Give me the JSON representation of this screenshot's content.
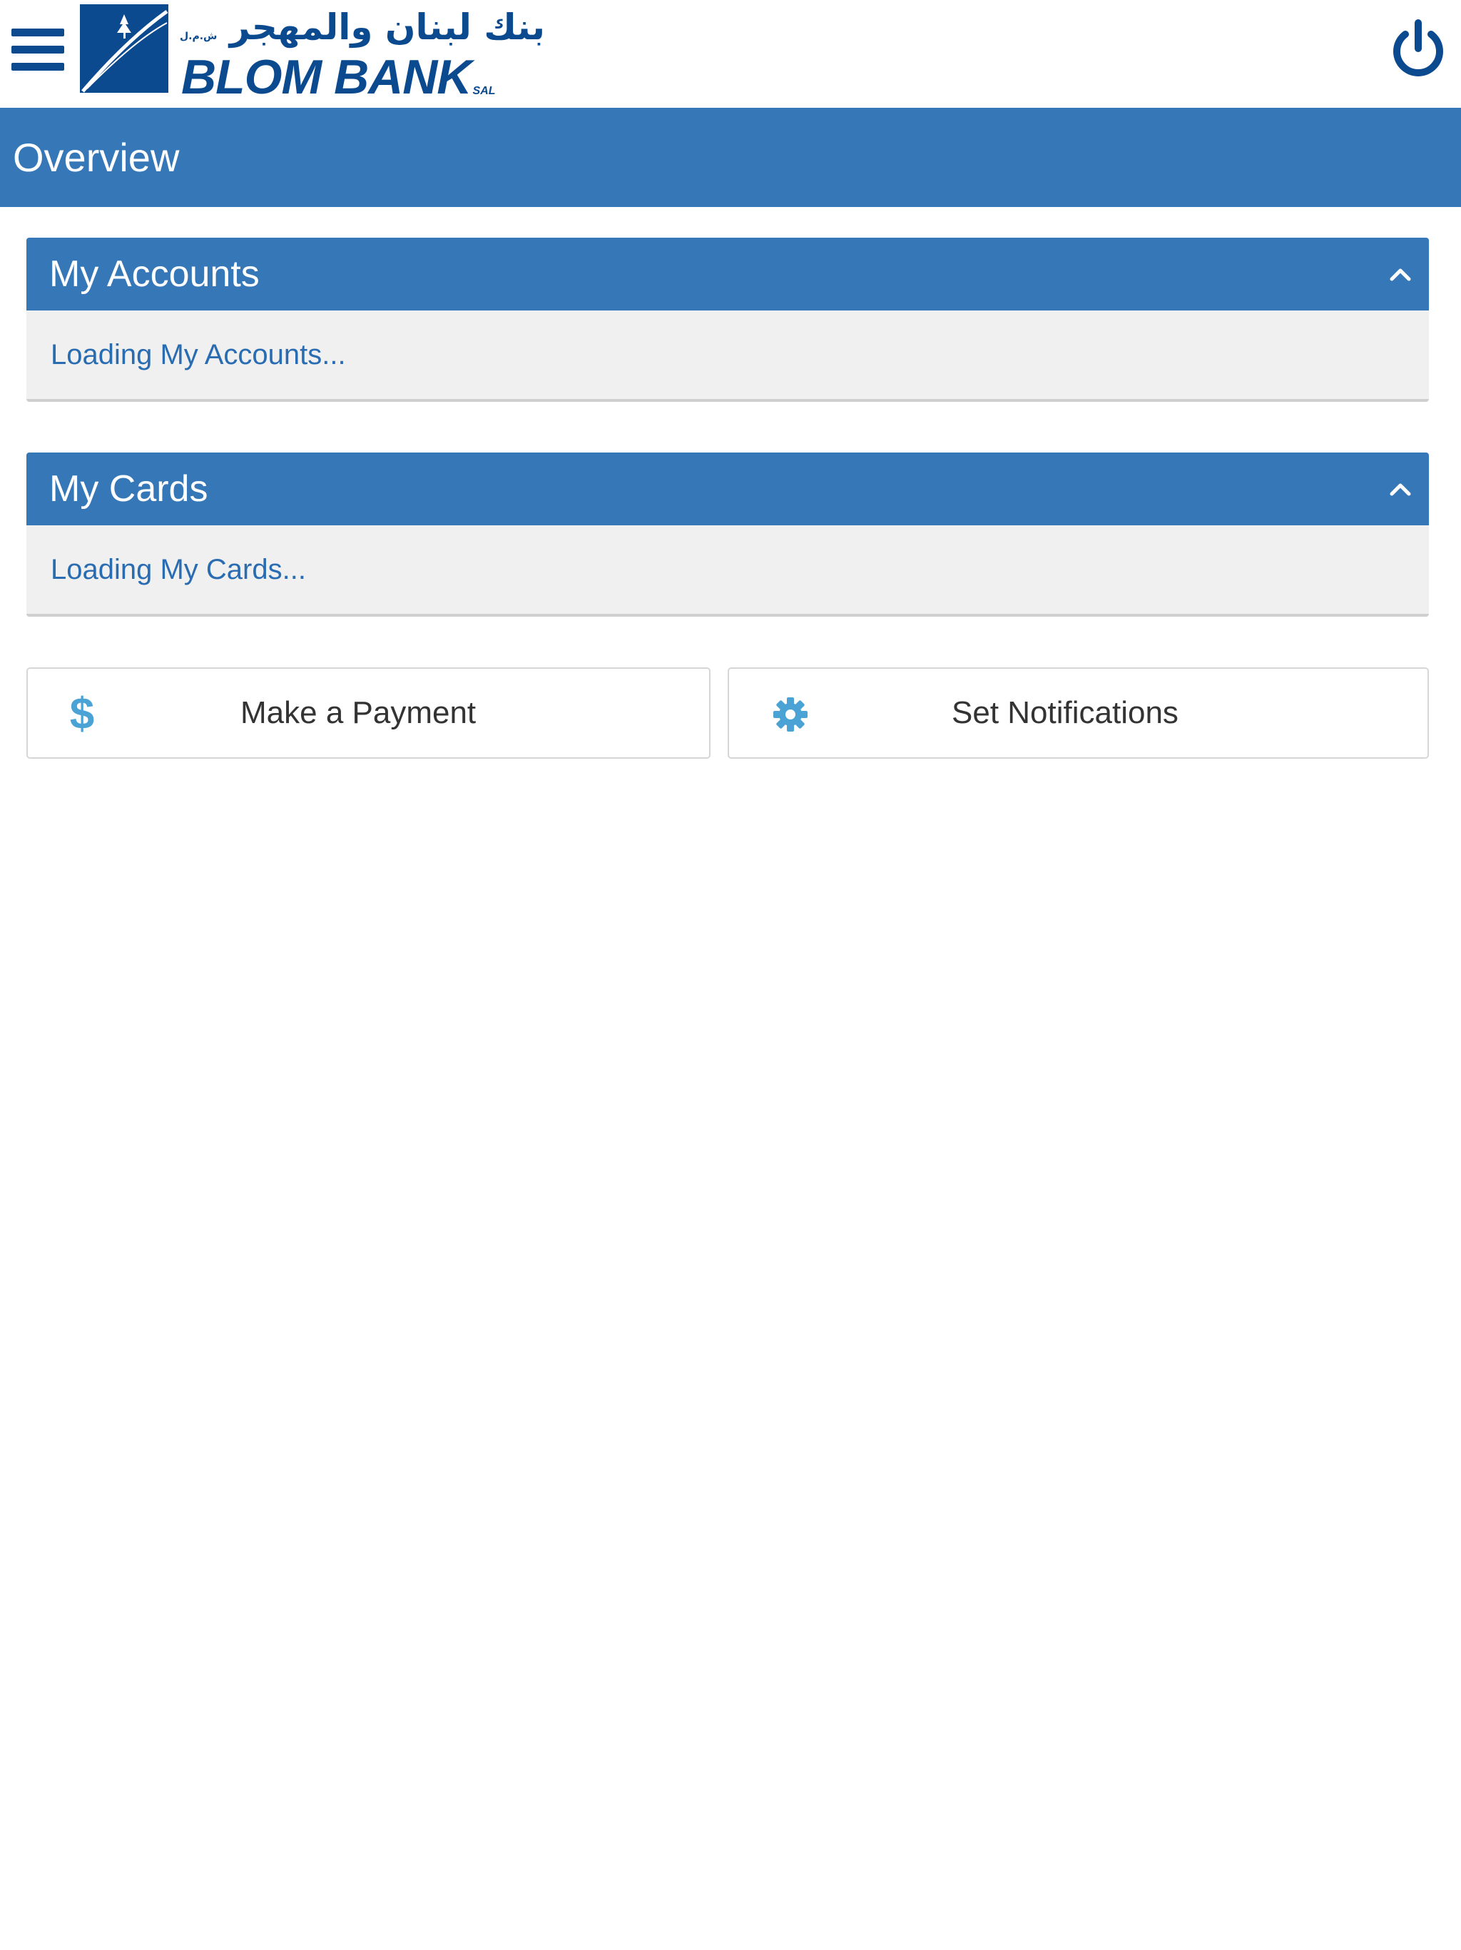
{
  "header": {
    "menu_icon": "hamburger-menu-icon",
    "logo": {
      "arabic_name": "بنك لبنان والمهجر",
      "arabic_suffix": "ش.م.ل",
      "latin_name": "BLOM BANK",
      "latin_suffix": "SAL"
    },
    "power_icon": "power-icon"
  },
  "page": {
    "title": "Overview"
  },
  "panels": [
    {
      "title": "My Accounts",
      "body": "Loading My Accounts...",
      "icon": "chevron-up-icon"
    },
    {
      "title": "My Cards",
      "body": "Loading My Cards...",
      "icon": "chevron-up-icon"
    }
  ],
  "actions": [
    {
      "label": "Make a Payment",
      "icon": "dollar-icon"
    },
    {
      "label": "Set Notifications",
      "icon": "gear-icon"
    }
  ],
  "colors": {
    "brand_navy": "#0b4a8e",
    "header_blue": "#3677b8",
    "link_blue": "#2a6cb1",
    "icon_teal": "#4aa3d4"
  }
}
